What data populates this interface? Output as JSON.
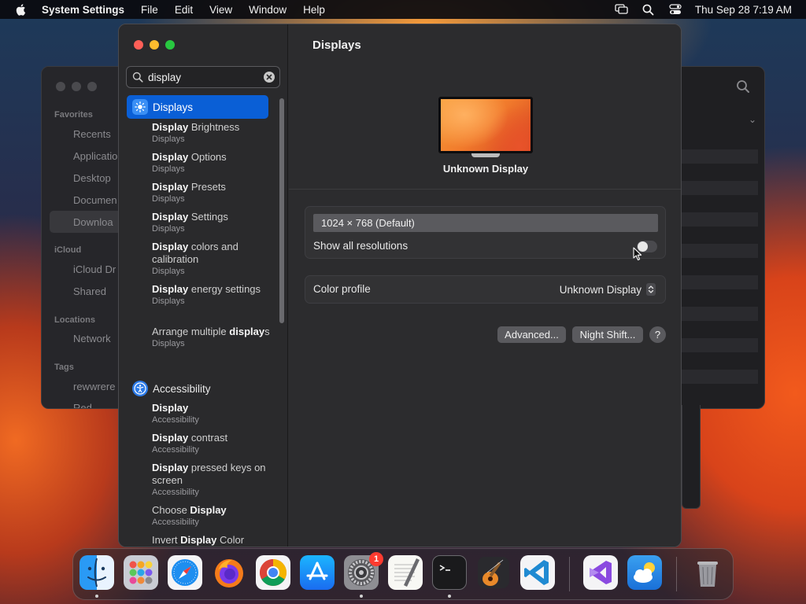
{
  "menubar": {
    "app_name": "System Settings",
    "menus": [
      "File",
      "Edit",
      "View",
      "Window",
      "Help"
    ],
    "clock": "Thu Sep 28  7:19 AM",
    "icons": [
      "screen-mirroring-icon",
      "spotlight-search-icon",
      "control-center-icon"
    ]
  },
  "finder": {
    "sections": [
      "Favorites",
      "iCloud",
      "Locations",
      "Tags"
    ],
    "items": [
      "Recents",
      "Applicatio",
      "Desktop",
      "Documen",
      "Downloa",
      "iCloud Dr",
      "Shared",
      "Network",
      "rewwrere",
      "Red"
    ]
  },
  "sidebar": {
    "search_value": "display",
    "categories": [
      {
        "label": "Displays",
        "icon": "sun-icon",
        "selected": true
      },
      {
        "label": "Accessibility",
        "icon": "accessibility-icon",
        "selected": false
      }
    ],
    "results": [
      {
        "pre": "",
        "bold": "Display",
        "post": " Brightness",
        "sub": "Displays"
      },
      {
        "pre": "",
        "bold": "Display",
        "post": " Options",
        "sub": "Displays"
      },
      {
        "pre": "",
        "bold": "Display",
        "post": " Presets",
        "sub": "Displays"
      },
      {
        "pre": "",
        "bold": "Display",
        "post": " Settings",
        "sub": "Displays"
      },
      {
        "pre": "",
        "bold": "Display",
        "post": " colors and calibration",
        "sub": "Displays"
      },
      {
        "pre": "",
        "bold": "Display",
        "post": " energy settings",
        "sub": "Displays"
      },
      {
        "pre": "Arrange multiple ",
        "bold": "display",
        "post": "s",
        "sub": "Displays"
      },
      {
        "pre": "",
        "bold": "Display",
        "post": "",
        "sub": "Accessibility"
      },
      {
        "pre": "",
        "bold": "Display",
        "post": " contrast",
        "sub": "Accessibility"
      },
      {
        "pre": "",
        "bold": "Display",
        "post": " pressed keys on screen",
        "sub": "Accessibility"
      },
      {
        "pre": "Choose ",
        "bold": "Display",
        "post": "",
        "sub": "Accessibility"
      },
      {
        "pre": "Invert ",
        "bold": "Display",
        "post": " Color",
        "sub": ""
      }
    ]
  },
  "main": {
    "title": "Displays",
    "display_name": "Unknown Display",
    "resolution_option": "1024 × 768 (Default)",
    "show_all_label": "Show all resolutions",
    "show_all_enabled": false,
    "color_profile_label": "Color profile",
    "color_profile_value": "Unknown Display",
    "advanced_button": "Advanced...",
    "night_shift_button": "Night Shift...",
    "help_button": "?"
  },
  "dock": {
    "apps": [
      "Finder",
      "Launchpad",
      "Safari",
      "Firefox",
      "Chrome",
      "App Store",
      "System Settings",
      "TextEdit",
      "Terminal",
      "GarageBand",
      "Visual Studio Code",
      "Visual Studio",
      "Weather",
      "Trash"
    ],
    "settings_badge": "1",
    "running": [
      "Finder",
      "System Settings",
      "Terminal"
    ]
  },
  "colors": {
    "accent": "#0a5fd6",
    "close": "#ff5f57",
    "minimize": "#febc2e",
    "zoom": "#28c840",
    "badge": "#ff3b30"
  }
}
